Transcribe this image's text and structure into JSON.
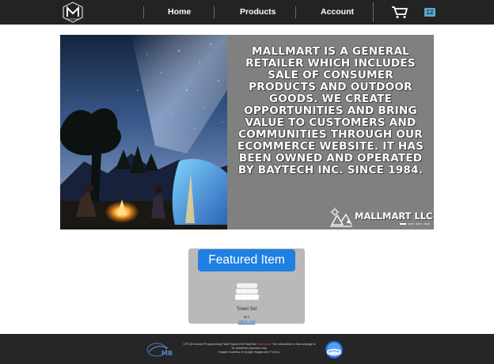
{
  "nav": {
    "logo_icon": "mallmart-logo-icon",
    "links": [
      {
        "label": "Home"
      },
      {
        "label": "Products"
      },
      {
        "label": "Account"
      }
    ],
    "cart_icon": "shopping-cart-icon",
    "cart_count": "12"
  },
  "hero": {
    "about_text": "MallMart is a general retailer which includes sale of consumer products and outdoor goods. We create opportunities and bring value to customers and communities through our ecommerce website. It has been owned and operated by BayTech Inc. since 1984.",
    "brand_name": "MALLMART LLC",
    "brand_icon": "camping-scene-icon",
    "slides_total": 4,
    "active_slide": 1
  },
  "featured": {
    "button_label": "Featured Item",
    "product_name": "Towel Set",
    "product_price": "$12",
    "product_link": "Add to cart",
    "product_icon": "towel-stack-icon"
  },
  "footer": {
    "line1_prefix": "CITC46 Internet Programming Final Project 2022 BayTech",
    "line1_highlight": "Disclaimer:",
    "line1_suffix": "The information in this webpage is",
    "line2": "for academic purposes only.",
    "line3_prefix": "Images Courtesy of Google Images and",
    "line3_link": "Pixabay.",
    "left_logo": "baytech-mb-logo-icon",
    "right_badge": "globe-badge-icon"
  },
  "colors": {
    "navbar": "#232323",
    "accent": "#1f7fe3",
    "badge": "#5aa6c9",
    "panel": "#808080",
    "card": "#b9b9b9"
  }
}
